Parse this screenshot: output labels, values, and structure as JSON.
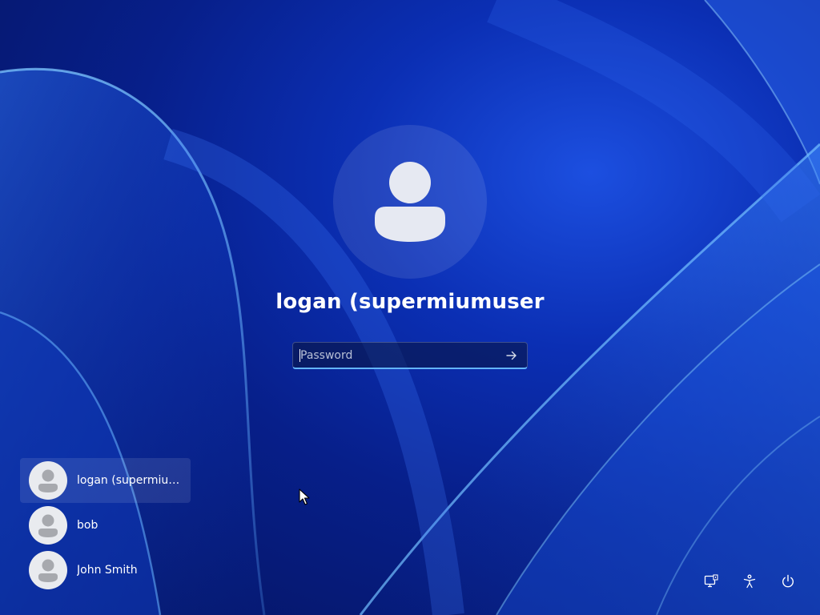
{
  "login": {
    "user_name": "logan (supermiumuser",
    "password": {
      "placeholder": "Password",
      "value": ""
    },
    "submit_icon": "arrow-right-icon"
  },
  "user_list": {
    "items": [
      {
        "label": "logan (supermiumu...",
        "selected": true,
        "icon": "user-avatar-icon"
      },
      {
        "label": "bob",
        "selected": false,
        "icon": "user-avatar-icon"
      },
      {
        "label": "John Smith",
        "selected": false,
        "icon": "user-avatar-icon"
      }
    ]
  },
  "system_tray": {
    "icons": [
      "network-icon",
      "accessibility-icon",
      "power-icon"
    ]
  },
  "colors": {
    "background": "#0b2fb4",
    "input_focus_underline": "#62b4ff",
    "avatar_glyph": "#e6e9f2",
    "mini_avatar_bg": "#e9ebef",
    "mini_avatar_glyph": "#a7a9ae"
  }
}
